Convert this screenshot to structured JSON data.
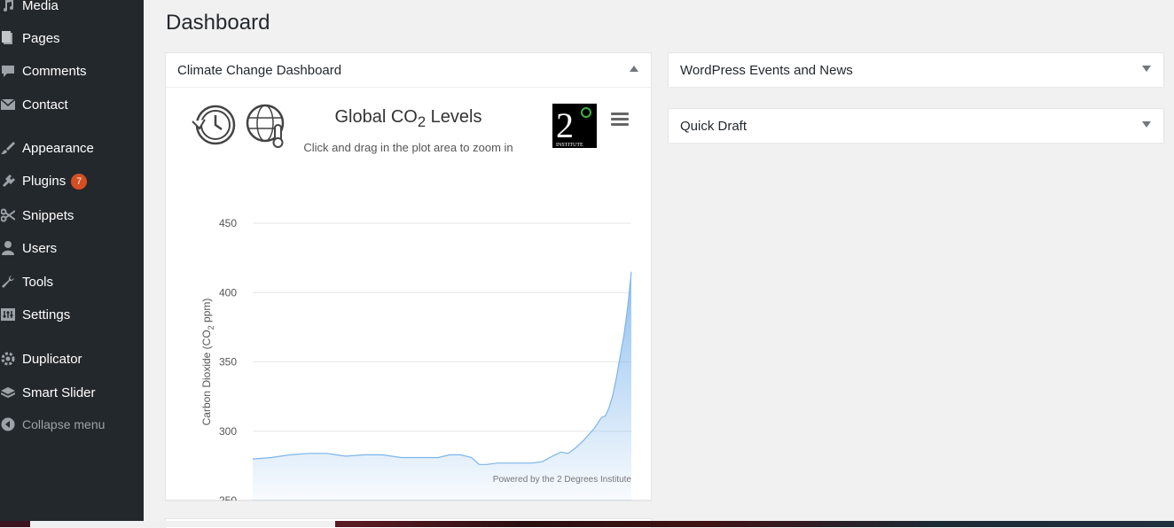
{
  "sidebar": {
    "items": [
      {
        "label": "Media",
        "icon": "media-icon"
      },
      {
        "label": "Pages",
        "icon": "pages-icon"
      },
      {
        "label": "Comments",
        "icon": "comments-icon"
      },
      {
        "label": "Contact",
        "icon": "mail-icon"
      },
      {
        "label": "Appearance",
        "icon": "brush-icon"
      },
      {
        "label": "Plugins",
        "icon": "plugin-icon",
        "badge": "7"
      },
      {
        "label": "Snippets",
        "icon": "scissors-icon"
      },
      {
        "label": "Users",
        "icon": "user-icon"
      },
      {
        "label": "Tools",
        "icon": "wrench-icon"
      },
      {
        "label": "Settings",
        "icon": "settings-icon"
      },
      {
        "label": "Duplicator",
        "icon": "gear-icon"
      },
      {
        "label": "Smart Slider",
        "icon": "layers-icon"
      },
      {
        "label": "Collapse menu",
        "icon": "collapse-icon"
      }
    ]
  },
  "main": {
    "page_title": "Dashboard",
    "widgets": {
      "climate": {
        "title": "Climate Change Dashboard"
      },
      "events": {
        "title": "WordPress Events and News"
      },
      "draft": {
        "title": "Quick Draft"
      }
    }
  },
  "colors": {
    "sidebar_bg": "#23282d",
    "badge": "#d54e21",
    "line": "#7cb5ec"
  },
  "chart_data": {
    "type": "area",
    "title": "Global CO2 Levels",
    "title_parts": {
      "main": "Global CO",
      "sub": "2",
      "tail": " Levels"
    },
    "subtitle": "Click and drag in the plot area to zoom in",
    "ylabel": "Carbon Dioxide (CO2 ppm)",
    "ylabel_parts": {
      "main": "Carbon Dioxide (CO",
      "sub": "2",
      "tail": " ppm)"
    },
    "credit": "Powered by the 2 Degrees Institute",
    "logo_text": "2°",
    "logo_caption": "INSTITUTE",
    "xlim": [
      1000,
      2020
    ],
    "ylim": [
      250,
      450
    ],
    "x_ticks": [
      1000,
      1250,
      1500,
      1750,
      2000
    ],
    "y_ticks": [
      250,
      300,
      350,
      400,
      450
    ],
    "series": [
      {
        "name": "CO2",
        "x": [
          1000,
          1050,
          1100,
          1150,
          1200,
          1250,
          1300,
          1350,
          1400,
          1450,
          1500,
          1530,
          1560,
          1590,
          1610,
          1630,
          1660,
          1700,
          1750,
          1780,
          1800,
          1830,
          1850,
          1870,
          1890,
          1900,
          1920,
          1940,
          1950,
          1960,
          1970,
          1980,
          1990,
          2000,
          2010,
          2020
        ],
        "y": [
          280,
          281,
          283,
          284,
          284,
          282,
          283,
          283,
          281,
          281,
          281,
          283,
          283,
          281,
          276,
          276,
          277,
          277,
          277,
          278,
          281,
          285,
          284,
          288,
          293,
          296,
          302,
          310,
          311,
          317,
          326,
          339,
          354,
          369,
          389,
          415
        ]
      }
    ]
  }
}
